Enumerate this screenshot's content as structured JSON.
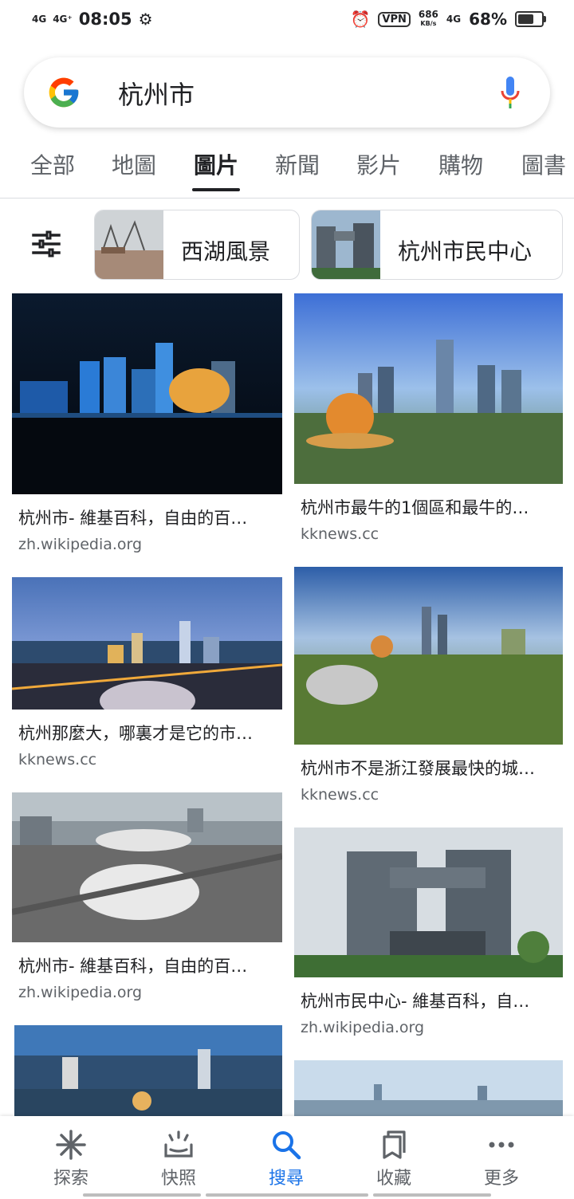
{
  "status": {
    "signal1": "4G",
    "signal2": "4G⁺",
    "time": "08:05",
    "vpn": "VPN",
    "speed": "686",
    "speed_unit": "KB/s",
    "network": "4G",
    "battery": "68%",
    "battery_level": 0.68
  },
  "search": {
    "query": "杭州市"
  },
  "tabs": [
    "全部",
    "地圖",
    "圖片",
    "新聞",
    "影片",
    "購物",
    "圖書"
  ],
  "active_tab": "圖片",
  "chips": [
    {
      "label": "西湖風景"
    },
    {
      "label": "杭州市民中心"
    }
  ],
  "results_left": [
    {
      "title": "杭州市- 維基百科，自由的百…",
      "source": "zh.wikipedia.org"
    },
    {
      "title": "杭州那麼大，哪裏才是它的市…",
      "source": "kknews.cc"
    },
    {
      "title": "杭州市- 維基百科，自由的百…",
      "source": "zh.wikipedia.org"
    }
  ],
  "results_right": [
    {
      "title": "杭州市最牛的1個區和最牛的…",
      "source": "kknews.cc"
    },
    {
      "title": "杭州市不是浙江發展最快的城…",
      "source": "kknews.cc"
    },
    {
      "title": "杭州市民中心- 維基百科，自…",
      "source": "zh.wikipedia.org"
    }
  ],
  "bottom_nav": [
    {
      "label": "探索",
      "icon": "asterisk-icon"
    },
    {
      "label": "快照",
      "icon": "snapshot-icon"
    },
    {
      "label": "搜尋",
      "icon": "search-icon"
    },
    {
      "label": "收藏",
      "icon": "collections-icon"
    },
    {
      "label": "更多",
      "icon": "more-icon"
    }
  ],
  "active_nav": "搜尋",
  "colors": {
    "accent": "#1a73e8",
    "text": "#202124",
    "muted": "#5f6368"
  }
}
